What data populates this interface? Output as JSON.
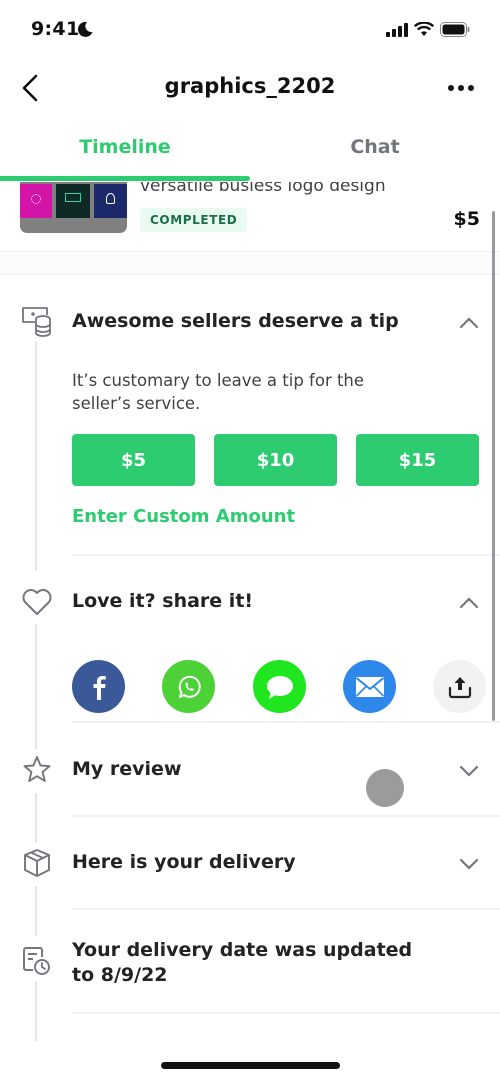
{
  "status_bar": {
    "time": "9:41",
    "icons": [
      "moon-icon",
      "cellular-signal-icon",
      "wifi-icon",
      "battery-icon"
    ]
  },
  "nav": {
    "title": "graphics_2202",
    "back_icon": "chevron-left-icon",
    "more_icon": "more-horizontal-icon"
  },
  "tabs": [
    {
      "label": "Timeline",
      "active": true
    },
    {
      "label": "Chat",
      "active": false
    }
  ],
  "order": {
    "title": "versatile busiess logo design",
    "status_badge": "COMPLETED",
    "price": "$5"
  },
  "tip_section": {
    "icon": "tip-money-icon",
    "title": "Awesome sellers deserve a tip",
    "expanded": true,
    "description": "It’s customary to leave a tip for the seller’s service.",
    "amounts": [
      "$5",
      "$10",
      "$15"
    ],
    "custom_amount_label": "Enter Custom Amount"
  },
  "share_section": {
    "icon": "heart-icon",
    "title": "Love it? share it!",
    "expanded": true,
    "targets": [
      {
        "name": "facebook",
        "icon": "facebook-icon",
        "color": "#3b5998"
      },
      {
        "name": "whatsapp",
        "icon": "whatsapp-icon",
        "color": "#4cd137"
      },
      {
        "name": "messages",
        "icon": "message-bubble-icon",
        "color": "#1fe61f"
      },
      {
        "name": "email",
        "icon": "mail-icon",
        "color": "#2d88ea"
      },
      {
        "name": "more",
        "icon": "share-upload-icon",
        "color": "#f2f2f3"
      }
    ]
  },
  "review_section": {
    "icon": "star-icon",
    "title": "My review",
    "expanded": false
  },
  "delivery_section": {
    "icon": "package-icon",
    "title": "Here is your delivery",
    "expanded": false
  },
  "date_update": {
    "icon": "calendar-clock-icon",
    "text": "Your delivery date was updated to 8/9/22"
  },
  "colors": {
    "accent": "#2ecc71",
    "text_primary": "#222325",
    "text_secondary": "#74767e",
    "badge_bg": "#e9faf2",
    "badge_text": "#1a6e46"
  }
}
